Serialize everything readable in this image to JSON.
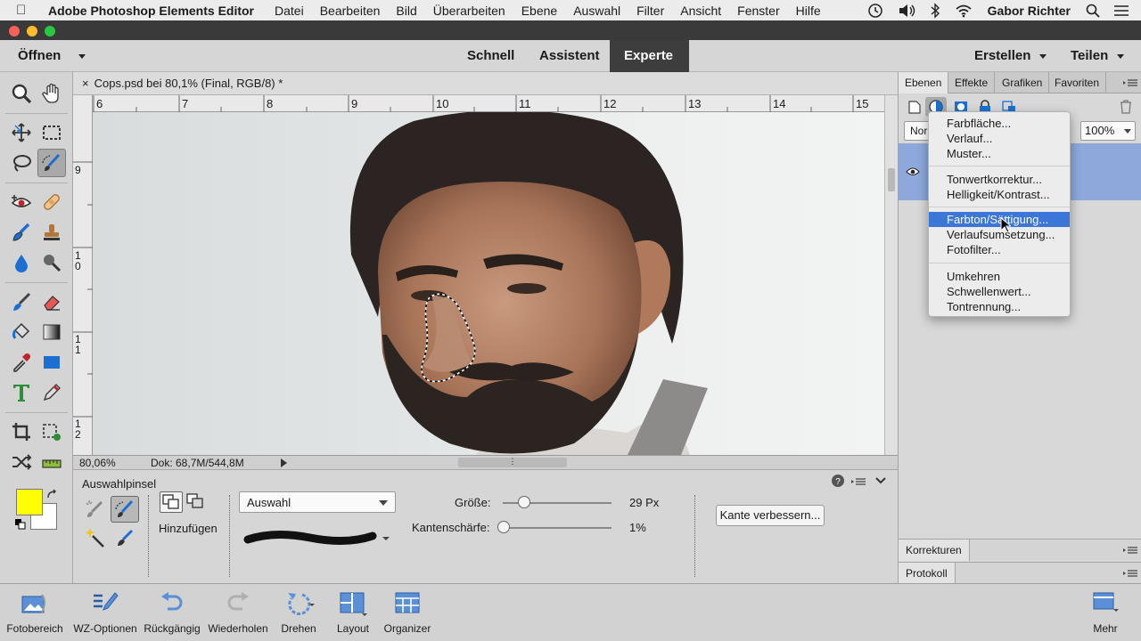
{
  "macbar": {
    "app_name": "Adobe Photoshop Elements Editor",
    "menus": [
      "Datei",
      "Bearbeiten",
      "Bild",
      "Überarbeiten",
      "Ebene",
      "Auswahl",
      "Filter",
      "Ansicht",
      "Fenster",
      "Hilfe"
    ],
    "user": "Gabor Richter"
  },
  "modebar": {
    "open": "Öffnen",
    "modes": [
      "Schnell",
      "Assistent",
      "Experte"
    ],
    "active_mode": "Experte",
    "create": "Erstellen",
    "share": "Teilen"
  },
  "document": {
    "tab_title": "Cops.psd bei 80,1% (Final, RGB/8) *",
    "ruler_top": [
      "6",
      "7",
      "8",
      "9",
      "10",
      "11",
      "12",
      "13",
      "14",
      "15"
    ],
    "ruler_left": [
      [
        "9"
      ],
      [
        "1",
        "0"
      ],
      [
        "1",
        "1"
      ],
      [
        "1",
        "2"
      ]
    ],
    "zoom": "80,06%",
    "doc_size": "Dok: 68,7M/544,8M"
  },
  "options": {
    "tool_name": "Auswahlpinsel",
    "mode_label": "Hinzufügen",
    "mode_select": "Auswahl",
    "size_label": "Größe:",
    "size_value": "29 Px",
    "size_fraction": 0.2,
    "edge_label": "Kantenschärfe:",
    "edge_value": "1%",
    "edge_fraction": 0.01,
    "refine_button": "Kante verbessern..."
  },
  "panel": {
    "tabs": [
      "Ebenen",
      "Effekte",
      "Grafiken",
      "Favoriten"
    ],
    "active_tab": "Ebenen",
    "blend_mode": "Nor",
    "opacity": "100%",
    "corrections": "Korrekturen",
    "history": "Protokoll"
  },
  "context_menu": {
    "groups": [
      [
        "Farbfläche...",
        "Verlauf...",
        "Muster..."
      ],
      [
        "Tonwertkorrektur...",
        "Helligkeit/Kontrast..."
      ],
      [
        "Farbton/Sättigung...",
        "Verlaufsumsetzung...",
        "Fotofilter..."
      ],
      [
        "Umkehren",
        "Schwellenwert...",
        "Tontrennung..."
      ]
    ],
    "highlighted": "Farbton/Sättigung..."
  },
  "taskbar": {
    "items": [
      "Fotobereich",
      "WZ-Optionen",
      "Rückgängig",
      "Wiederholen",
      "Drehen",
      "Layout",
      "Organizer"
    ],
    "more": "Mehr"
  },
  "colors": {
    "foreground": "#ffff00",
    "background": "#ffffff",
    "menu_highlight": "#3c76d6",
    "layer_selected": "#8ea8db"
  }
}
